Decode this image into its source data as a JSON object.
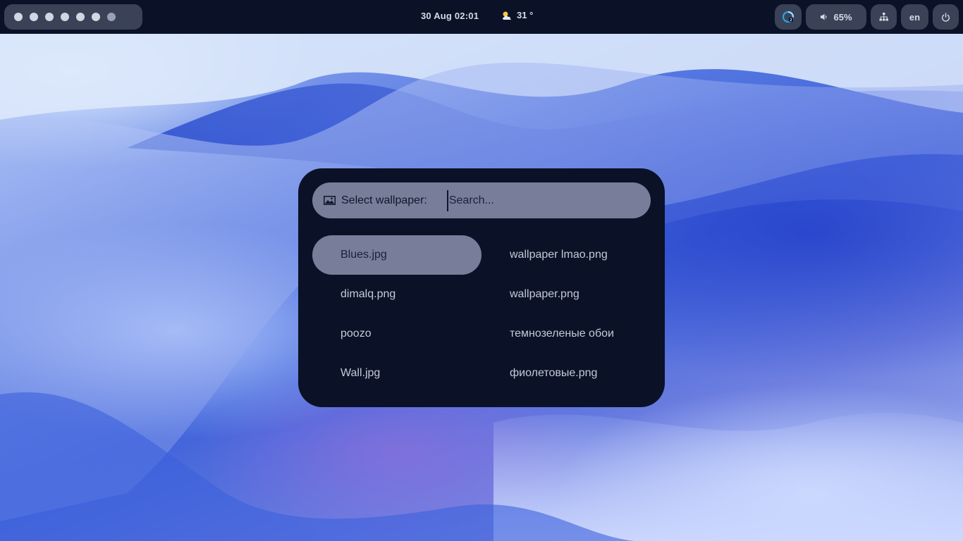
{
  "topbar": {
    "workspaces": [
      1,
      2,
      3,
      4,
      5,
      6,
      7
    ],
    "clock": "30 Aug 02:01",
    "weather": {
      "icon": "partly-cloudy-icon",
      "temp": "31 °"
    },
    "tray": {
      "app_icon": "system-tray-app-icon",
      "volume_icon": "speaker-icon",
      "volume": "65%",
      "network_icon": "network-icon",
      "language": "en",
      "power_icon": "power-icon"
    }
  },
  "dialog": {
    "prompt_icon": "image-icon",
    "prompt": "Select wallpaper:",
    "search_placeholder": "Search...",
    "files": [
      {
        "name": "Blues.jpg",
        "selected": true
      },
      {
        "name": "wallpaper lmao.png"
      },
      {
        "name": "dimalq.png"
      },
      {
        "name": "wallpaper.png"
      },
      {
        "name": "poozo"
      },
      {
        "name": "темнозеленые обои"
      },
      {
        "name": "Wall.jpg"
      },
      {
        "name": "фиолетовые.png"
      }
    ]
  },
  "colors": {
    "bar_bg": "#0b1227",
    "pill_bg": "#3a4257",
    "dialog_bg": "#0b1227",
    "highlight": "#787d99"
  }
}
